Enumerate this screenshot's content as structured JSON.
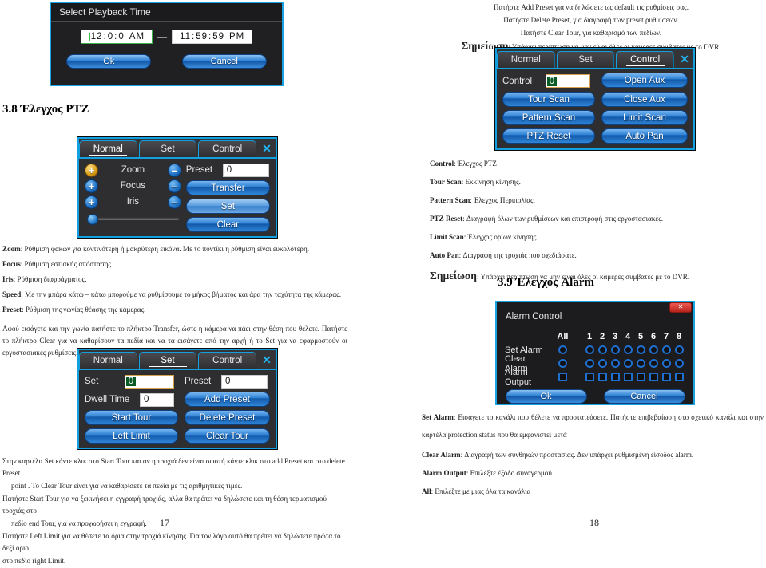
{
  "doc": {
    "page_left": "17",
    "page_right": "18",
    "section_ptz": "3.8 Έλεγχος PTZ",
    "section_alarm": "3.9 Έλεγχος Alarm"
  },
  "top_notes": {
    "lines": [
      "Πατήστε Add Preset για να δηλώσετε ως default τις ρυθμίσεις σας.",
      "Πατήστε Delete Preset, για διαγραφή των preset ρυθμίσεων.",
      "Πατήστε Clear Tour, για καθαρισμό των πεδίων."
    ],
    "note_label": "Σημείωση",
    "note_text": ": Υπάρχει περίπτωση να μην είναι όλες οι κάμερες συμβατές με το DVR."
  },
  "playback_dialog": {
    "title": "Select Playback Time",
    "start": {
      "hour": "12",
      "minute": "0",
      "second": "0",
      "meridiem": "AM"
    },
    "end": {
      "hour": "11",
      "minute": "59",
      "second": "59",
      "meridiem": "PM"
    },
    "separator": "—",
    "ok_label": "Ok",
    "cancel_label": "Cancel",
    "colon": ":"
  },
  "ptz_control_panel": {
    "tabs": [
      {
        "label": "Normal",
        "active": false
      },
      {
        "label": "Set",
        "active": false
      },
      {
        "label": "Control",
        "active": true
      }
    ],
    "close_glyph": "✕",
    "control_label": "Control",
    "control_value": "0",
    "left_buttons": [
      "Tour Scan",
      "Pattern Scan",
      "PTZ Reset"
    ],
    "right_buttons": [
      "Open Aux",
      "Close Aux",
      "Limit Scan",
      "Auto Pan"
    ]
  },
  "ptz_normal_panel": {
    "tabs": [
      {
        "label": "Normal",
        "active": true
      },
      {
        "label": "Set",
        "active": false
      },
      {
        "label": "Control",
        "active": false
      }
    ],
    "close_glyph": "✕",
    "rows": [
      {
        "label": "Zoom",
        "plus": "+",
        "minus": "–",
        "gold": true
      },
      {
        "label": "Focus",
        "plus": "+",
        "minus": "–",
        "gold": false
      },
      {
        "label": "Iris",
        "plus": "+",
        "minus": "–",
        "gold": false
      }
    ],
    "preset_label": "Preset",
    "preset_value": "0",
    "buttons": [
      "Transfer",
      "Set",
      "Clear"
    ]
  },
  "ptz_set_panel": {
    "tabs": [
      {
        "label": "Normal",
        "active": false
      },
      {
        "label": "Set",
        "active": true
      },
      {
        "label": "Control",
        "active": false
      }
    ],
    "close_glyph": "✕",
    "set_label": "Set",
    "set_value": "0",
    "dwell_label": "Dwell Time",
    "dwell_value": "0",
    "preset_label": "Preset",
    "preset_value": "0",
    "left_buttons": [
      "Start Tour",
      "Left Limit"
    ],
    "right_buttons": [
      "Add Preset",
      "Delete Preset",
      "Clear Tour"
    ]
  },
  "alarm_panel": {
    "title": "Alarm Control",
    "close_glyph": "✕",
    "all_header": "All",
    "channel_headers": [
      "1",
      "2",
      "3",
      "4",
      "5",
      "6",
      "7",
      "8"
    ],
    "rows": [
      {
        "label": "Set Alarm",
        "shape": "circle"
      },
      {
        "label": "Clear Alarm",
        "shape": "circle"
      },
      {
        "label": "Alarm Output",
        "shape": "square"
      }
    ],
    "ok_label": "Ok",
    "cancel_label": "Cancel"
  },
  "ptz_descriptions_left": [
    {
      "term": "Zoom",
      "text": ": Ρύθμιση φακών για κοντινότερη ή μακρύτερη εικόνα. Με το ποντίκι η ρύθμιση είναι ευκολότερη."
    },
    {
      "term": "Focus",
      "text": ": Ρύθμιση εστιακής απόστασης."
    },
    {
      "term": "Iris",
      "text": ": Ρύθμιση διαφράγματος."
    },
    {
      "term": "Speed",
      "text": ": Με την μπάρα κάτω – κάτω μπορούμε να ρυθμίσουμε το μήκος βήματος και άρα την ταχύτητα της κάμερας."
    },
    {
      "term": "Preset",
      "text": ": Ρύθμιση της γωνίας θέασης της κάμερας."
    }
  ],
  "ptz_paragraph_left": "Αφού εισάγετε και την γωνία πατήστε το πλήκτρο Transfer, ώστε η κάμερα να πάει στην θέση που θέλετε. Πατήστε το πλήκτρο Clear για να καθαρίσουν τα πεδία και να τα εισάγετε από την αρχή ή το Set για να εφαρμοστούν οι εργοστασιακές ρυθμίσεις.",
  "ptz_descriptions_right": [
    {
      "term": "Control",
      "text": ": Έλεγχος PTZ"
    },
    {
      "term": "Tour Scan",
      "text": ": Εκκίνηση κίνησης."
    },
    {
      "term": "Pattern Scan",
      "text": ": Έλεγχος Περιπολίας."
    },
    {
      "term": "PTZ Reset",
      "text": ": Διαγραφή όλων των ρυθμίσεων και επιστροφή στις εργοστασιακές."
    },
    {
      "term": "Limit Scan",
      "text": ": Έλεγχος ορίων κίνησης."
    },
    {
      "term": "Auto Pan",
      "text": ": Διαγραφή της τροχιάς που σχεδιάσατε."
    }
  ],
  "note_right": {
    "label": "Σημείωση",
    "text": ": Υπάρχει περίπτωση να μην είναι όλες οι κάμερες συμβατές με το DVR."
  },
  "set_paragraph_left": [
    "Στην καρτέλα Set κάντε κλικ στο Start Tour και αν η τροχιά δεν είναι σωστή κάντε κλικ στο add Preset και στο delete Preset",
    "point . Το Clear Tour είναι για να καθαρίσετε τα πεδία με τις αριθμητικές τιμές.",
    "Πατήστε Start Tour για να ξεκινήσει η εγγραφή τροχιάς, αλλά θα πρέπει να δηλώσετε και τη θέση τερματισμού τροχιάς στο",
    "πεδίο end Tour, για να προχωρήσει η εγγραφή.",
    "Πατήστε Left Limit για να θέσετε τα όρια στην τροχιά κίνησης. Για τον λόγο αυτό θα πρέπει να δηλώσετε πρώτα το δεξί όριο",
    "στο πεδίο right Limit."
  ],
  "alarm_descriptions": [
    {
      "term": "Set Alarm",
      "text": ": Εισάγετε το κανάλι που θέλετε να προστατεύσετε. Πατήστε επιβεβαίωση στο σχετικό κανάλι και στην καρτέλα protection status που θα εμφανιστεί μετά"
    },
    {
      "term": "Clear Alarm",
      "text": ": Διαγραφή των συνθηκών προστασίας. Δεν υπάρχει ρυθμισμένη είσοδος alarm."
    },
    {
      "term": "Alarm Output",
      "text": ": Επιλέξτε έξοδο συναγερμού"
    },
    {
      "term": "All",
      "text": ": Επιλέξτε με μιας όλα τα κανάλια"
    }
  ],
  "colors": {
    "panel_border": "#12a0e0",
    "panel_bg": "#2e2e30",
    "button_blue": "#2a7fd4",
    "field_border": "#d5a24b",
    "selection_green": "#0a5c27",
    "close_red": "#b8231c",
    "gold": "#d79a12"
  }
}
